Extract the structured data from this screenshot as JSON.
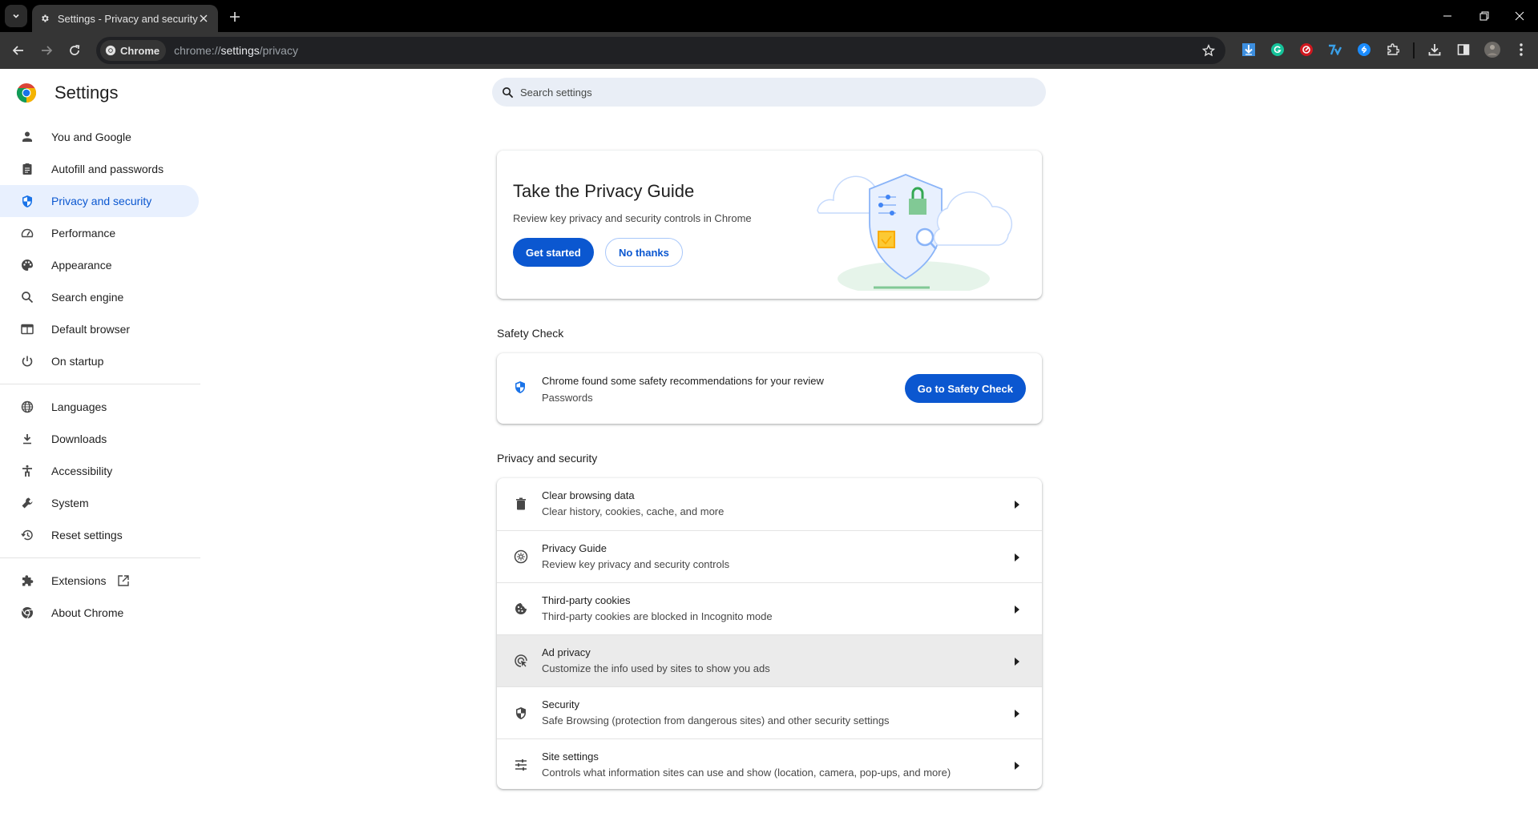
{
  "browser": {
    "tab_title": "Settings - Privacy and security",
    "chip_label": "Chrome",
    "url_prefix": "chrome://",
    "url_host": "settings",
    "url_path": "/privacy",
    "extensions": [
      "downloader-extension",
      "grammarly-extension",
      "red-extension",
      "7-extension",
      "shazam-extension"
    ]
  },
  "settings": {
    "title": "Settings",
    "search_placeholder": "Search settings"
  },
  "sidebar": {
    "items": [
      {
        "label": "You and Google",
        "icon": "person-icon"
      },
      {
        "label": "Autofill and passwords",
        "icon": "clipboard-icon"
      },
      {
        "label": "Privacy and security",
        "icon": "shield-icon",
        "active": true
      },
      {
        "label": "Performance",
        "icon": "speedometer-icon"
      },
      {
        "label": "Appearance",
        "icon": "palette-icon"
      },
      {
        "label": "Search engine",
        "icon": "search-icon"
      },
      {
        "label": "Default browser",
        "icon": "browser-icon"
      },
      {
        "label": "On startup",
        "icon": "power-icon"
      },
      {
        "label": "Languages",
        "icon": "globe-icon"
      },
      {
        "label": "Downloads",
        "icon": "download-icon"
      },
      {
        "label": "Accessibility",
        "icon": "accessibility-icon"
      },
      {
        "label": "System",
        "icon": "wrench-icon"
      },
      {
        "label": "Reset settings",
        "icon": "restore-icon"
      },
      {
        "label": "Extensions",
        "icon": "puzzle-icon"
      },
      {
        "label": "About Chrome",
        "icon": "chrome-icon"
      }
    ]
  },
  "privacy_guide": {
    "title": "Take the Privacy Guide",
    "description": "Review key privacy and security controls in Chrome",
    "primary_button": "Get started",
    "secondary_button": "No thanks"
  },
  "safety_check": {
    "section_label": "Safety Check",
    "title": "Chrome found some safety recommendations for your review",
    "subtitle": "Passwords",
    "button": "Go to Safety Check"
  },
  "privacy_section": {
    "section_label": "Privacy and security",
    "rows": [
      {
        "title": "Clear browsing data",
        "subtitle": "Clear history, cookies, cache, and more",
        "icon": "trash-icon"
      },
      {
        "title": "Privacy Guide",
        "subtitle": "Review key privacy and security controls",
        "icon": "compass-icon"
      },
      {
        "title": "Third-party cookies",
        "subtitle": "Third-party cookies are blocked in Incognito mode",
        "icon": "cookie-icon"
      },
      {
        "title": "Ad privacy",
        "subtitle": "Customize the info used by sites to show you ads",
        "icon": "ad-privacy-icon",
        "hovered": true
      },
      {
        "title": "Security",
        "subtitle": "Safe Browsing (protection from dangerous sites) and other security settings",
        "icon": "security-shield-icon"
      },
      {
        "title": "Site settings",
        "subtitle": "Controls what information sites can use and show (location, camera, pop-ups, and more)",
        "icon": "tune-icon"
      }
    ]
  },
  "colors": {
    "accent": "#0b57d0",
    "active_nav_bg": "#e8f0fe",
    "search_bg": "#e9eef6",
    "toolbar_bg": "#353535",
    "tabstrip_bg": "#000000"
  }
}
